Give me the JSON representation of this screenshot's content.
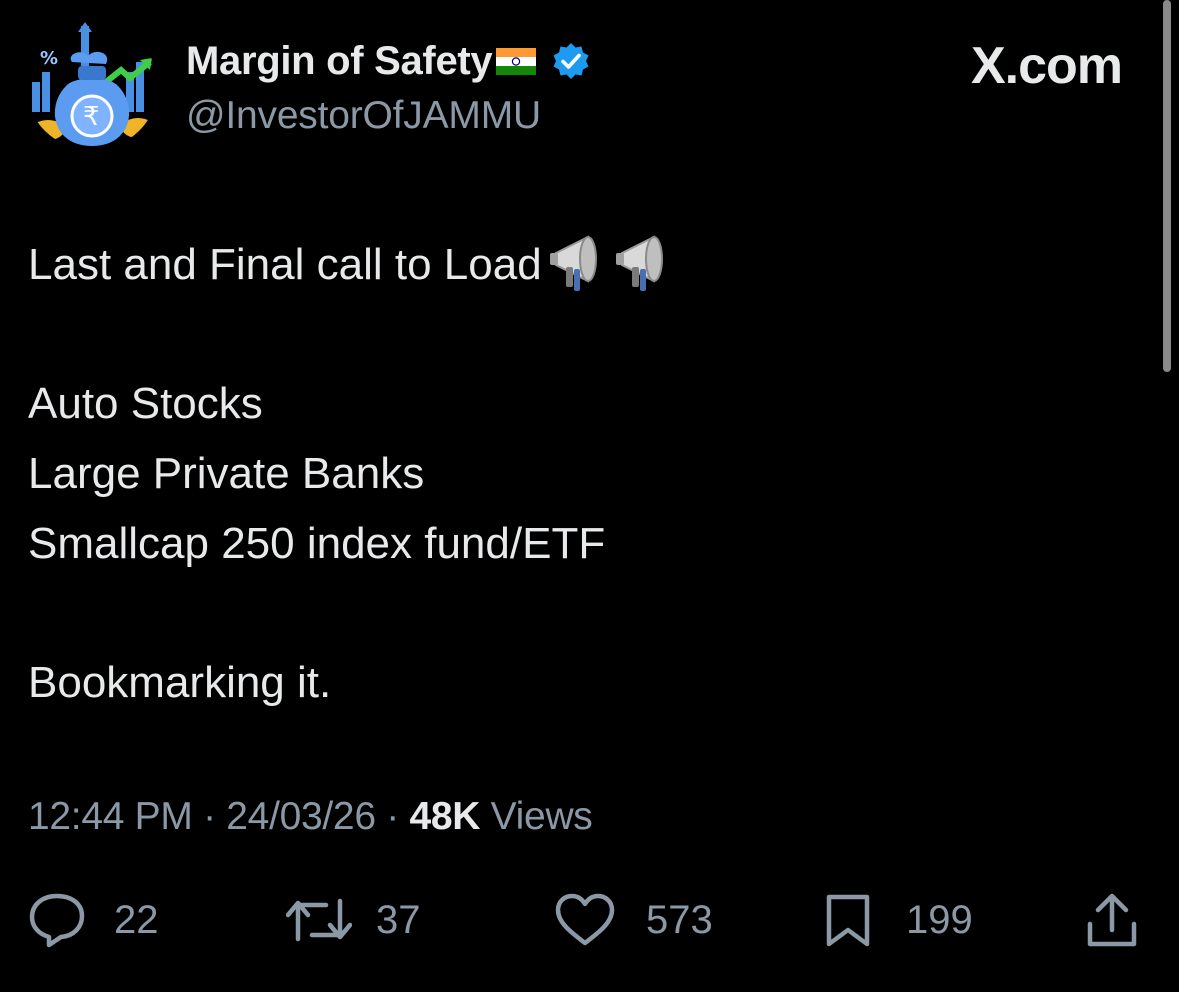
{
  "author": {
    "display_name": "Margin of Safety",
    "handle": "@InvestorOfJAMMU",
    "avatar_icon": "money-bag-rupee-avatar",
    "flag_icon": "india-flag-icon",
    "verified_icon": "verified-badge-icon",
    "verified_color": "#1d9bf0"
  },
  "brand": {
    "label": "X.com"
  },
  "post": {
    "lines": [
      "Last and Final call to Load",
      "Auto Stocks",
      "Large Private Banks",
      "Smallcap 250 index fund/ETF",
      "Bookmarking it."
    ],
    "emoji": "megaphone-icon"
  },
  "meta": {
    "time": "12:44 PM",
    "sep1": " · ",
    "date": "24/03/26",
    "sep2": " · ",
    "views_count": "48K",
    "views_label": " Views"
  },
  "actions": {
    "replies": "22",
    "reposts": "37",
    "likes": "573",
    "bookmarks": "199"
  },
  "colors": {
    "background": "#000000",
    "primary_text": "#e7e9ea",
    "secondary_text": "#8b98a5"
  }
}
